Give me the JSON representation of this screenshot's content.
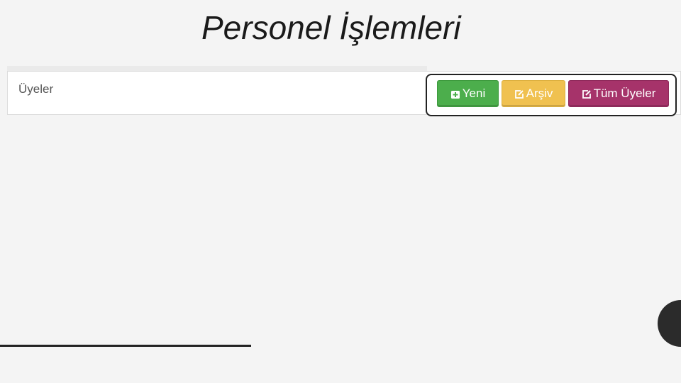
{
  "slide": {
    "title": "Personel İşlemleri"
  },
  "panel": {
    "title": "Üyeler"
  },
  "buttons": {
    "yeni": {
      "label": "Yeni",
      "icon": "plus-square-icon",
      "color": "#4cae4c"
    },
    "arsiv": {
      "label": "Arşiv",
      "icon": "edit-icon",
      "color": "#f0c150"
    },
    "tum_uyeler": {
      "label": "Tüm Üyeler",
      "icon": "edit-icon",
      "color": "#a6336a"
    }
  },
  "colors": {
    "background": "#f4f4f4",
    "highlight_border": "#222222",
    "corner_circle": "#2b2b2b"
  }
}
